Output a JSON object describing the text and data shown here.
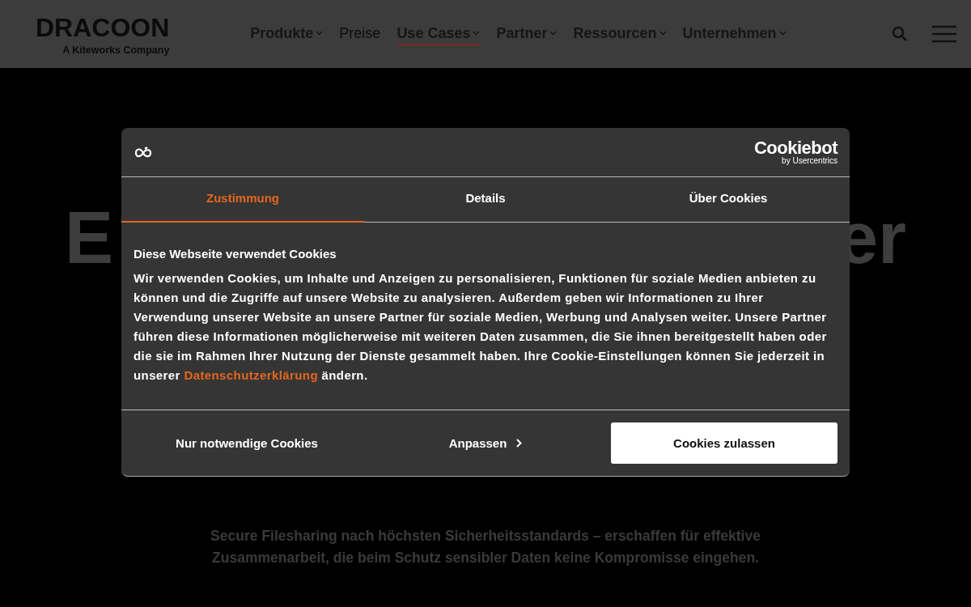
{
  "header": {
    "logo": {
      "name": "DRACOON",
      "tagline": "A Kiteworks Company"
    },
    "nav": [
      {
        "label": "Produkte",
        "dropdown": true,
        "selected": false
      },
      {
        "label": "Preise",
        "dropdown": false,
        "selected": false
      },
      {
        "label": "Use Cases",
        "dropdown": true,
        "selected": true
      },
      {
        "label": "Partner",
        "dropdown": true,
        "selected": false
      },
      {
        "label": "Ressourcen",
        "dropdown": true,
        "selected": false
      },
      {
        "label": "Unternehmen",
        "dropdown": true,
        "selected": false
      }
    ]
  },
  "hero": {
    "heading_parts": [
      "E",
      "er"
    ],
    "subtitle": "Secure Filesharing nach höchsten Sicherheitsstandards – erschaffen für effektive Zusammenarbeit, die beim Schutz sensibler Daten keine Kompromisse eingehen."
  },
  "cookie_dialog": {
    "brand": {
      "name": "Cookiebot",
      "byline": "by Usercentrics"
    },
    "tabs": [
      {
        "label": "Zustimmung",
        "selected": true
      },
      {
        "label": "Details",
        "selected": false
      },
      {
        "label": "Über Cookies",
        "selected": false
      }
    ],
    "heading": "Diese Webseite verwendet Cookies",
    "body_before": "Wir verwenden Cookies, um Inhalte und Anzeigen zu personalisieren, Funktionen für soziale Medien anbieten zu können und die Zugriffe auf unsere Website zu analysieren. Außerdem geben wir Informationen zu Ihrer Verwendung unserer Website an unsere Partner für soziale Medien, Werbung und Analysen weiter. Unsere Partner führen diese Informationen möglicherweise mit weiteren Daten zusammen, die Sie ihnen bereitgestellt haben oder die sie im Rahmen Ihrer Nutzung der Dienste gesammelt haben. Ihre Cookie-Einstellungen können Sie jederzeit in unserer",
    "link": "Datenschutzerklärung",
    "body_after": "ändern.",
    "buttons": [
      {
        "label": "Nur notwendige Cookies",
        "kind": "plain"
      },
      {
        "label": "Anpassen",
        "kind": "chevron"
      },
      {
        "label": "Cookies zulassen",
        "kind": "primary"
      }
    ]
  }
}
